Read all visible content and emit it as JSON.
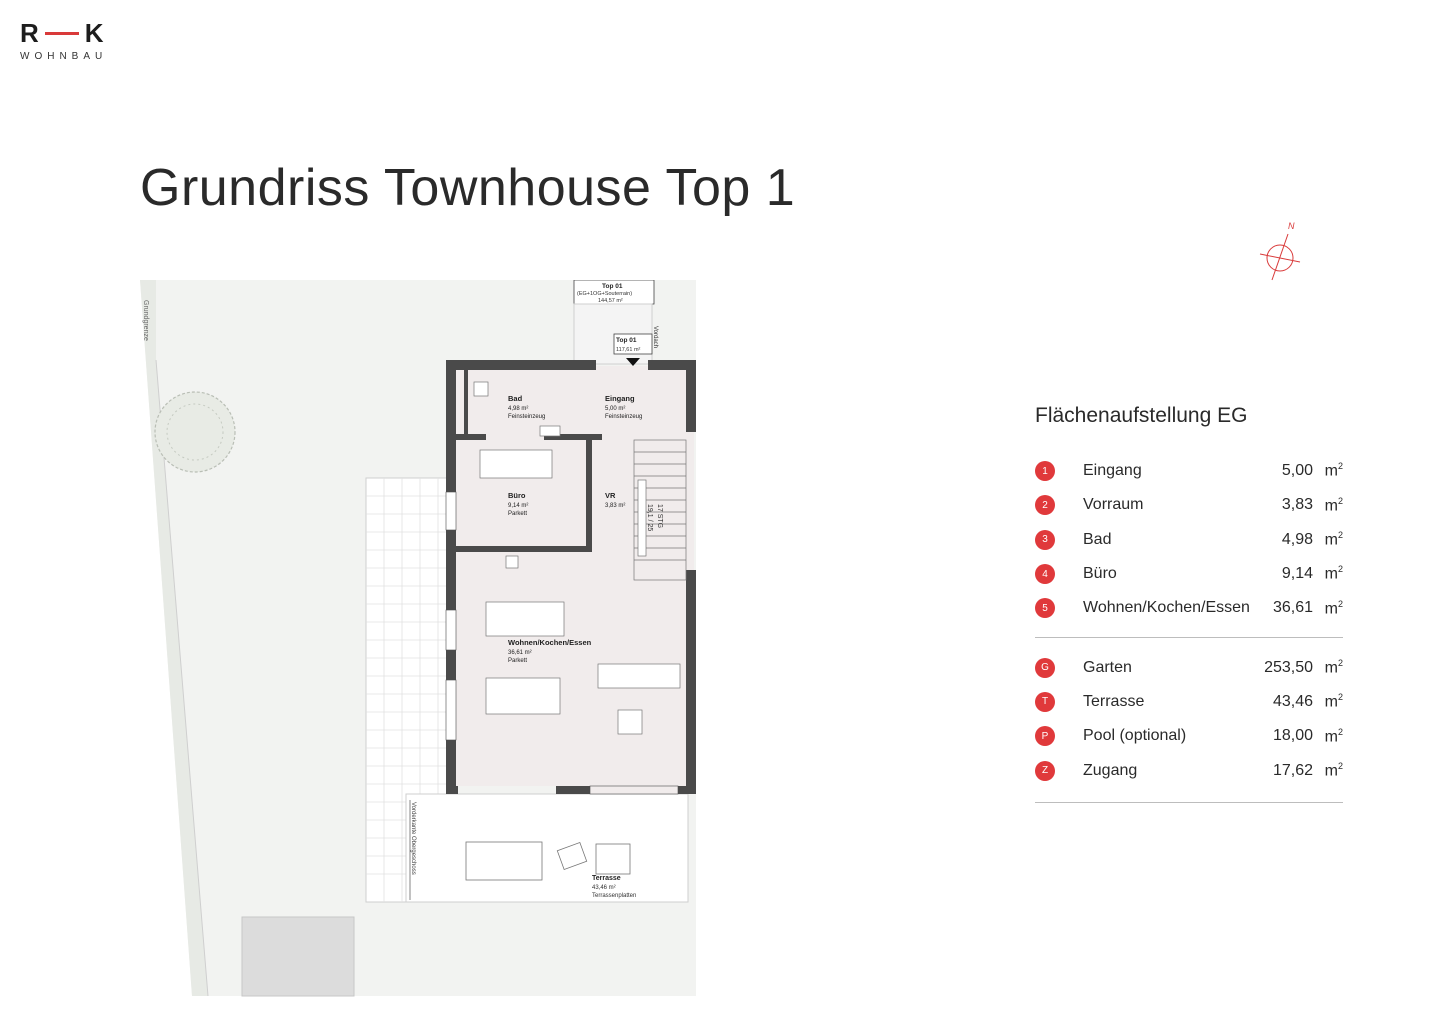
{
  "logo": {
    "mark_left": "R",
    "mark_right": "K",
    "sub": "WOHNBAU"
  },
  "title": "Grundriss Townhouse Top 1",
  "compass": {
    "label": "N"
  },
  "plan": {
    "labels": {
      "top01_a": "Top 01",
      "top01_a_sub": "(EG+1OG+Souterrain)",
      "top01_a_area": "144,57 m²",
      "top01_b": "Top 01",
      "top01_b_area": "117,61 m²",
      "vordach": "Vordach",
      "grundgrenze": "Grundgrenze",
      "bad": "Bad",
      "bad_area": "4,98 m²",
      "bad_floor": "Feinsteinzeug",
      "eingang": "Eingang",
      "eingang_area": "5,00 m²",
      "eingang_floor": "Feinsteinzeug",
      "buero": "Büro",
      "buero_area": "9,14 m²",
      "buero_floor": "Parkett",
      "vr": "VR",
      "vr_area": "3,83 m²",
      "stg": "17 STG",
      "stg2": "19,1 / 25",
      "wohnen": "Wohnen/Kochen/Essen",
      "wohnen_area": "36,61 m²",
      "wohnen_floor": "Parkett",
      "terrasse": "Terrasse",
      "terrasse_area": "43,46 m²",
      "terrasse_floor": "Terrassenplatten",
      "vorderkante": "Vorderkante Obergeschoss"
    }
  },
  "area_table": {
    "title": "Flächenaufstellung EG",
    "unit": "m",
    "unit_sup": "2",
    "rooms": [
      {
        "badge": "1",
        "name": "Eingang",
        "value": "5,00"
      },
      {
        "badge": "2",
        "name": "Vorraum",
        "value": "3,83"
      },
      {
        "badge": "3",
        "name": "Bad",
        "value": "4,98"
      },
      {
        "badge": "4",
        "name": "Büro",
        "value": "9,14"
      },
      {
        "badge": "5",
        "name": "Wohnen/Kochen/Essen",
        "value": "36,61"
      }
    ],
    "outdoor": [
      {
        "badge": "G",
        "name": "Garten",
        "value": "253,50"
      },
      {
        "badge": "T",
        "name": "Terrasse",
        "value": "43,46"
      },
      {
        "badge": "P",
        "name": "Pool (optional)",
        "value": "18,00"
      },
      {
        "badge": "Z",
        "name": "Zugang",
        "value": "17,62"
      }
    ]
  },
  "colors": {
    "accent": "#e0393b",
    "wall": "#4a4a4a",
    "floor": "#f1ecec",
    "garden": "#f2f3f1"
  }
}
